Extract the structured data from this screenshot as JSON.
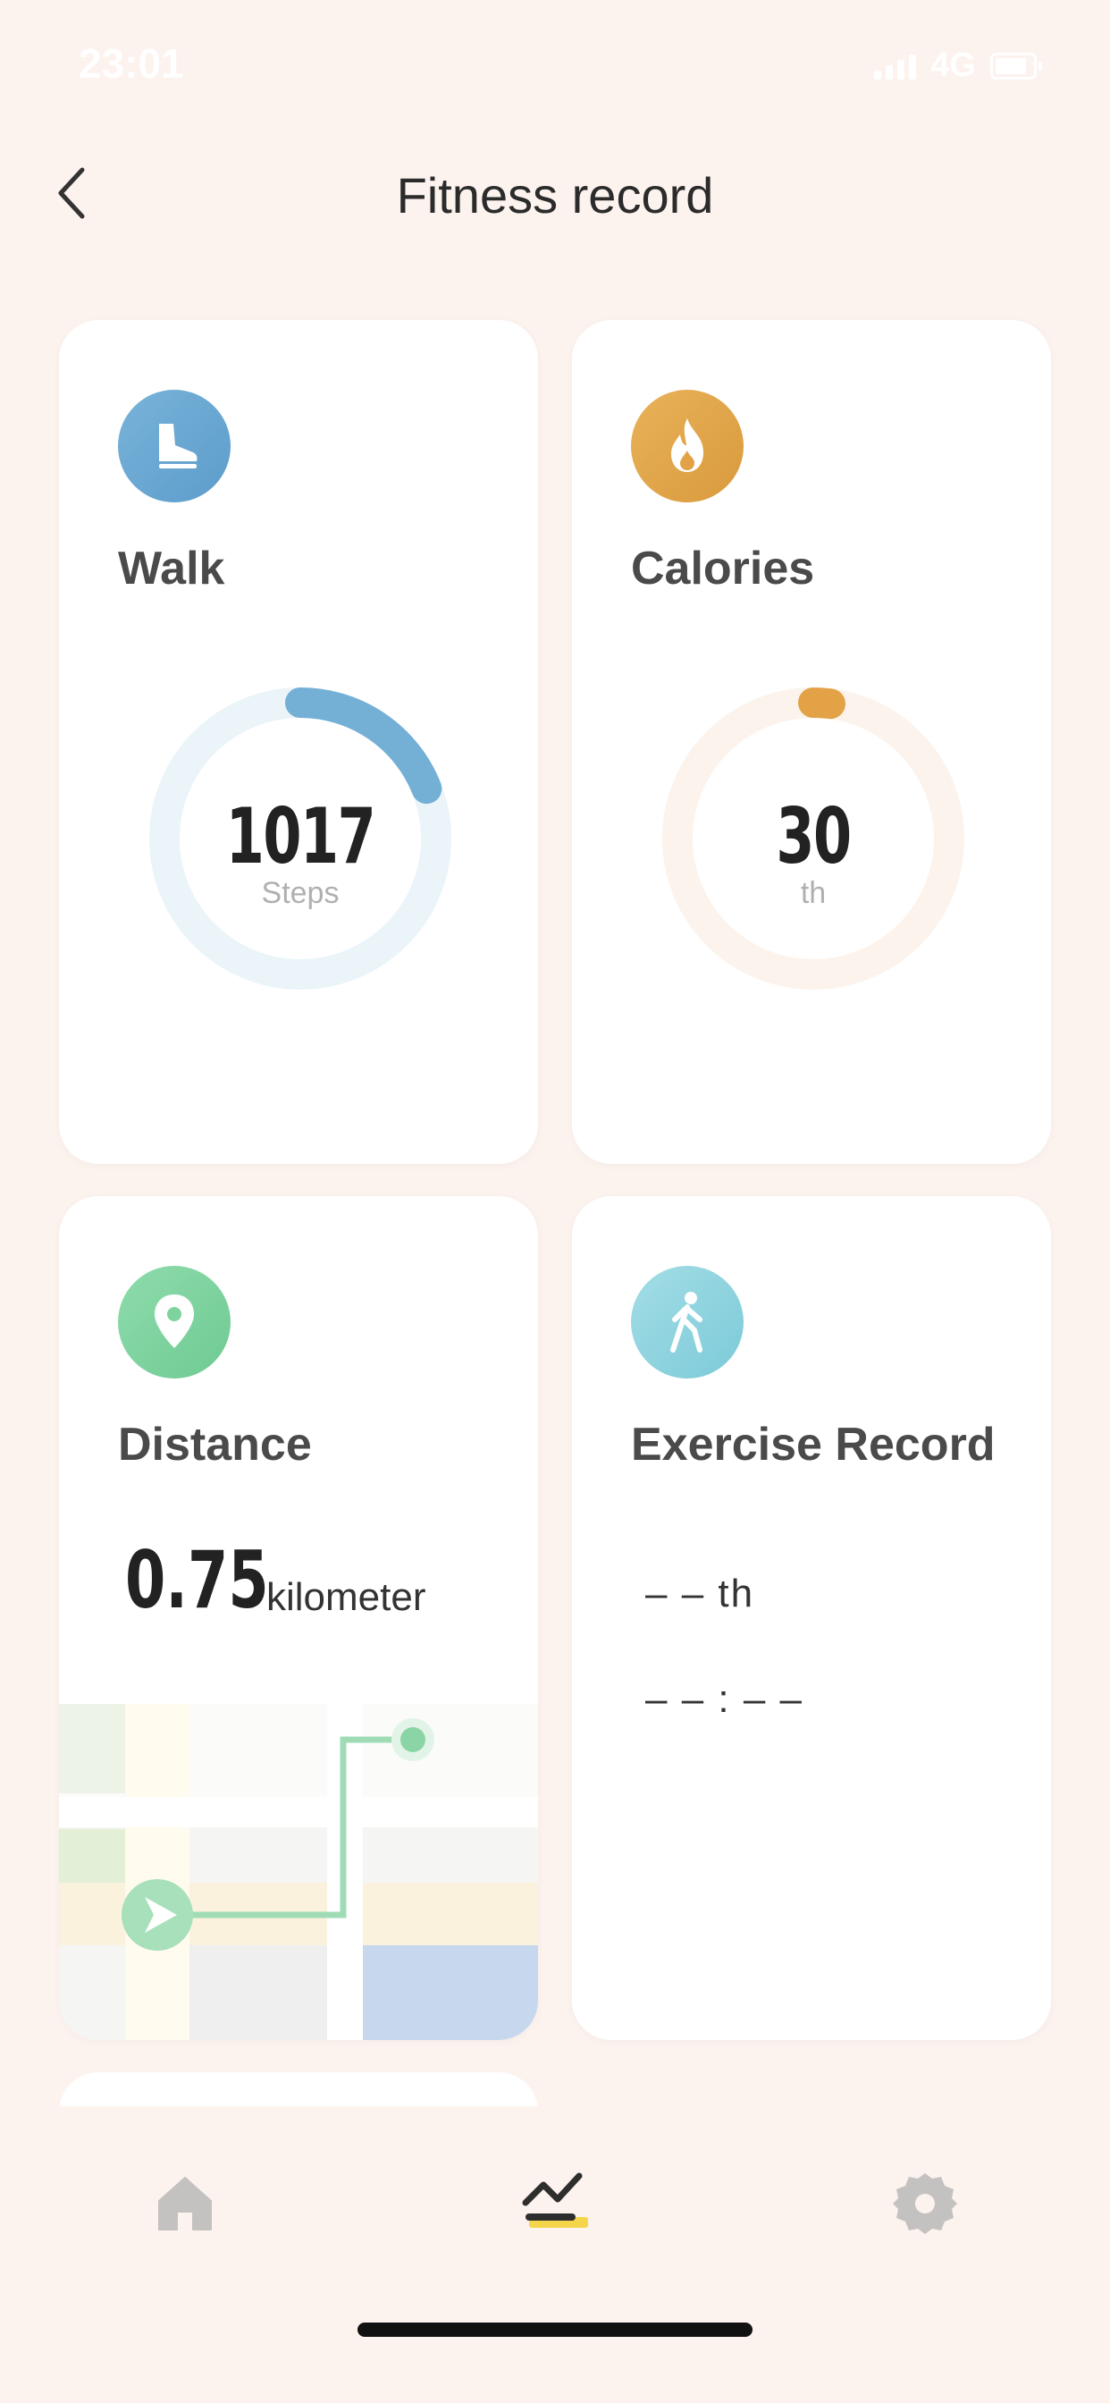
{
  "status_bar": {
    "time": "23:01",
    "network": "4G"
  },
  "header": {
    "title": "Fitness record"
  },
  "cards": {
    "walk": {
      "title": "Walk",
      "value": "1017",
      "unit": "Steps",
      "progress": 0.19,
      "color": "#6aaad3"
    },
    "calories": {
      "title": "Calories",
      "value": "30",
      "unit": "th",
      "progress": 0.02,
      "color": "#e3a245"
    },
    "distance": {
      "title": "Distance",
      "value": "0.75",
      "unit": "kilometer",
      "color": "#7dd39d"
    },
    "exercise": {
      "title": "Exercise Record",
      "count": "– – th",
      "time": "– – : – –",
      "color": "#8dd3df"
    }
  },
  "tabs": [
    {
      "name": "home",
      "icon": "home-icon",
      "active": false
    },
    {
      "name": "records",
      "icon": "chart-line-icon",
      "active": true
    },
    {
      "name": "settings",
      "icon": "gear-icon",
      "active": false
    }
  ]
}
